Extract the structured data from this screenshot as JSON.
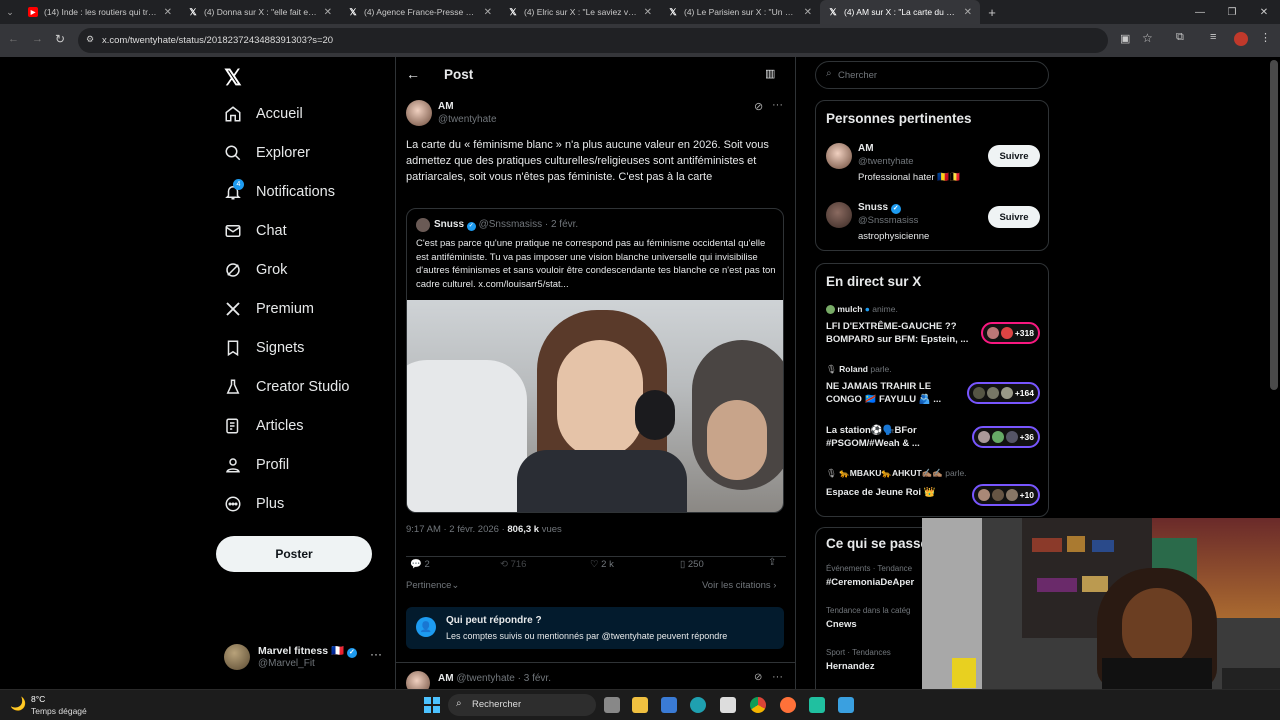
{
  "browser": {
    "tabs": [
      {
        "title": "(14) Inde : les routiers qui trans",
        "icon": "youtube-icon"
      },
      {
        "title": "(4) Donna sur X : \"elle fait expri",
        "icon": "x-icon"
      },
      {
        "title": "(4) Agence France-Presse sur X",
        "icon": "x-icon"
      },
      {
        "title": "(4) Elric sur X : \"Le saviez vous?",
        "icon": "x-icon"
      },
      {
        "title": "(4) Le Parisien sur X : \"Un agent",
        "icon": "x-icon"
      },
      {
        "title": "(4) AM sur X : \"La carte du « fém",
        "icon": "x-icon"
      }
    ],
    "url": "x.com/twentyhate/status/2018237243488391303?s=20"
  },
  "sidebar": {
    "items": [
      {
        "label": "Accueil",
        "icon": "home-icon"
      },
      {
        "label": "Explorer",
        "icon": "search-icon"
      },
      {
        "label": "Notifications",
        "icon": "bell-icon",
        "badge": "4"
      },
      {
        "label": "Chat",
        "icon": "mail-icon"
      },
      {
        "label": "Grok",
        "icon": "grok-icon"
      },
      {
        "label": "Premium",
        "icon": "x-logo-icon"
      },
      {
        "label": "Signets",
        "icon": "bookmark-icon"
      },
      {
        "label": "Creator Studio",
        "icon": "flask-icon"
      },
      {
        "label": "Articles",
        "icon": "article-icon"
      },
      {
        "label": "Profil",
        "icon": "person-icon"
      },
      {
        "label": "Plus",
        "icon": "more-circle-icon"
      }
    ],
    "post_button": "Poster",
    "account": {
      "name": "Marvel fitness",
      "flag": "🇫🇷",
      "handle": "@Marvel_Fit"
    }
  },
  "post": {
    "header_title": "Post",
    "author": "AM",
    "handle": "@twentyhate",
    "text": "La carte du « féminisme blanc » n'a plus aucune valeur en 2026. Soit vous admettez que des pratiques culturelles/religieuses sont antiféministes et patriarcales, soit vous n'êtes pas féministe. C'est pas à la carte",
    "quote": {
      "author": "Snuss",
      "handle": "@Snssmasiss",
      "date": "· 2 févr.",
      "text": "C'est pas parce qu'une pratique ne correspond pas au féminisme occidental qu'elle est antiféministe. Tu va pas imposer une vision blanche universelle qui invisibilise d'autres féminismes et sans vouloir être condescendante tes blanche ce n'est pas ton cadre culturel.  x.com/louisarr5/stat..."
    },
    "time": "9:17 AM · 2 févr. 2026 ·",
    "views_count": "806,3 k",
    "views_label": "vues",
    "stats": {
      "replies": "2",
      "reposts": "716",
      "likes": "2 k",
      "bookmarks": "250"
    },
    "relevance": "Pertinence",
    "see_quotes": "Voir les citations",
    "reply_box": {
      "title": "Qui peut répondre ?",
      "text": "Les comptes suivis ou mentionnés par @twentyhate peuvent répondre"
    },
    "next_reply": {
      "author": "AM",
      "handle": "@twentyhate",
      "date": "· 3 févr."
    }
  },
  "right": {
    "search_placeholder": "Chercher",
    "relevant_title": "Personnes pertinentes",
    "people": [
      {
        "name": "AM",
        "handle": "@twentyhate",
        "bio": "Professional hater 🇷🇴🇧🇪",
        "follow": "Suivre",
        "verified": false
      },
      {
        "name": "Snuss",
        "handle": "@Snssmasiss",
        "bio": "astrophysicienne",
        "follow": "Suivre",
        "verified": true
      }
    ],
    "live_title": "En direct sur X",
    "live": [
      {
        "host": "mulch",
        "status": "anime.",
        "title": "LFI D'EXTRÊME-GAUCHE ?? BOMPARD sur BFM: Epstein, ...",
        "count": "+318"
      },
      {
        "host": "Roland",
        "status": "parle.",
        "title": "NE JAMAIS TRAHIR LE CONGO 🇨🇩 FAYULU 🫂 ...",
        "count": "+164"
      },
      {
        "host": "",
        "status": "",
        "title": "La station⚽🗣️BFor #PSGOM/#Weah & ...",
        "count": "+36"
      },
      {
        "host": "🐆MBAKU🐆AHKUT✍🏽✍🏽",
        "status": "parle.",
        "title": "Espace de Jeune Roi 👑",
        "count": "+10"
      }
    ],
    "happening_title": "Ce qui se passe",
    "trends": [
      {
        "context": "Événements · Tendance",
        "name": "#CeremoniaDeAper"
      },
      {
        "context": "Tendance dans la catég",
        "name": "Cnews"
      },
      {
        "context": "Sport · Tendances",
        "name": "Hernandez"
      }
    ]
  },
  "taskbar": {
    "weather_temp": "8°C",
    "weather_desc": "Temps dégagé",
    "search_label": "Rechercher"
  }
}
